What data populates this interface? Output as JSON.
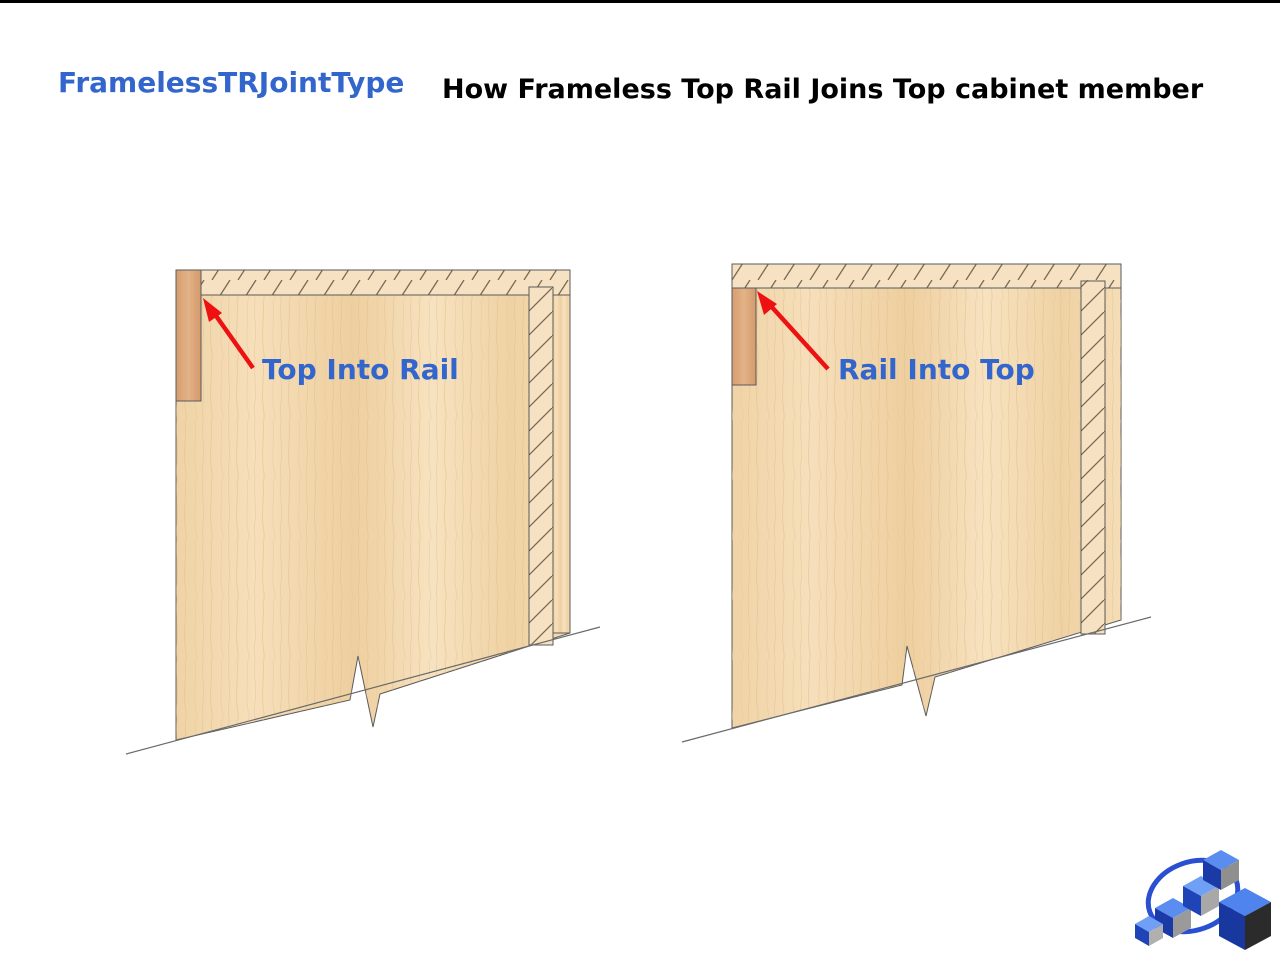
{
  "header": {
    "parameter_name": "FramelessTRJointType",
    "title": "How Frameless Top Rail Joins Top cabinet member"
  },
  "diagrams": [
    {
      "label": "Top Into Rail"
    },
    {
      "label": "Rail Into Top"
    }
  ],
  "colors": {
    "label": "#3366cc",
    "arrow": "#ee1111",
    "wood": "#f2d7ac",
    "rail_wood": "#dca57a",
    "outline": "#5a5a5a"
  },
  "logo": {
    "name": "cube-logo-icon"
  }
}
